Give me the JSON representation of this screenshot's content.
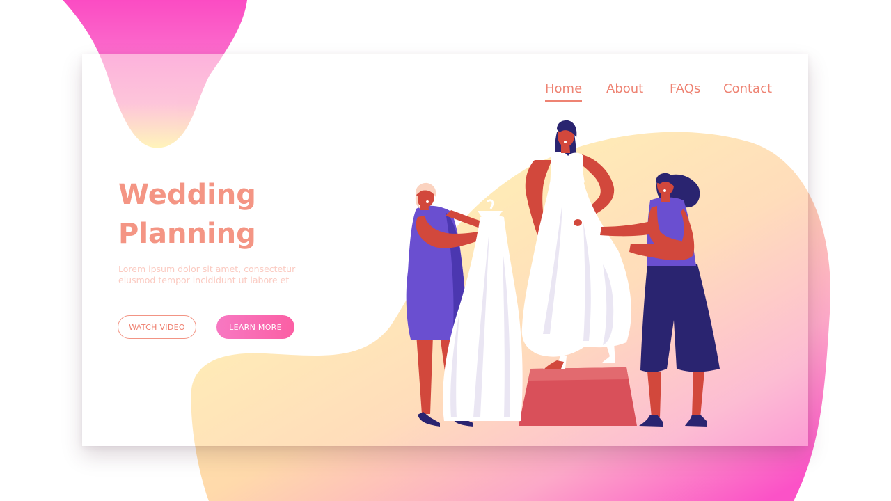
{
  "nav": {
    "items": [
      {
        "label": "Home",
        "active": true
      },
      {
        "label": "About",
        "active": false
      },
      {
        "label": "FAQs",
        "active": false
      },
      {
        "label": "Contact",
        "active": false
      }
    ]
  },
  "hero": {
    "title_line1": "Wedding",
    "title_line2": "Planning",
    "text_line1": "Lorem ipsum dolor sit amet, consectetur",
    "text_line2": "eiusmod tempor incididunt ut labore et",
    "watch_video": "WATCH VIDEO",
    "learn_more": "LEARN MORE"
  },
  "colors": {
    "accent": "#ee8373",
    "title": "#f49584",
    "button_gradient_start": "#f778c2",
    "button_gradient_end": "#fb5fa4",
    "blob_pink": "#fb4fbf",
    "blob_yellow": "#fff1a8",
    "dress_purple": "#6a4fd0",
    "dark_navy": "#2a2470",
    "skin": "#d2483c",
    "pedestal": "#d9505a"
  },
  "illustration": {
    "subject": "bride-trying-on-wedding-dress-with-assistants"
  }
}
